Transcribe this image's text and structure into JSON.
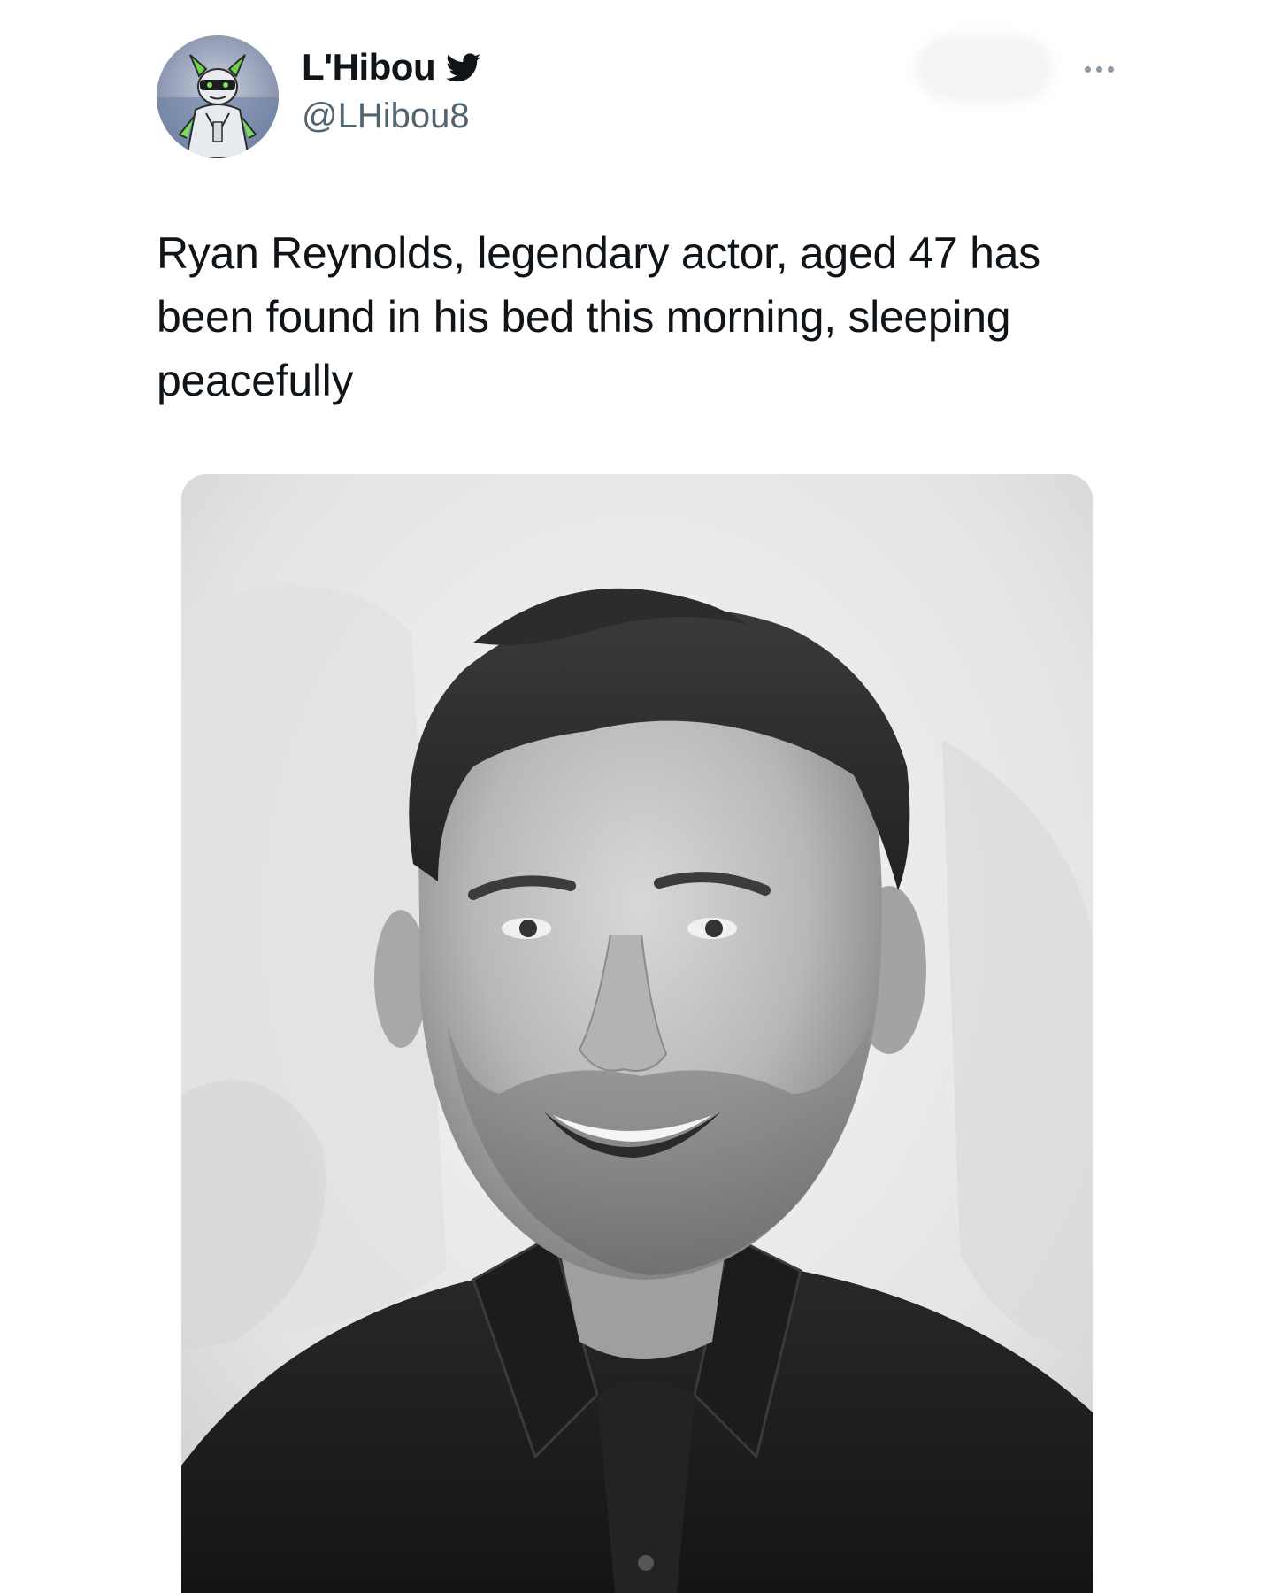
{
  "tweet": {
    "author": {
      "display_name": "L'Hibou",
      "handle": "@LHibou8",
      "verified_icon": "twitter-bird-icon",
      "avatar_icon": "cartoon-character-avatar"
    },
    "more_icon": "more-dots-icon",
    "text": "Ryan Reynolds, legendary actor, aged 47 has been found in his bed this morning, sleeping peacefully",
    "media": {
      "kind": "black-and-white portrait photo of a smiling man"
    }
  },
  "colors": {
    "text_primary": "#0f1419",
    "text_secondary": "#536471",
    "icon_gray": "#8b98a5",
    "background": "#ffffff"
  }
}
